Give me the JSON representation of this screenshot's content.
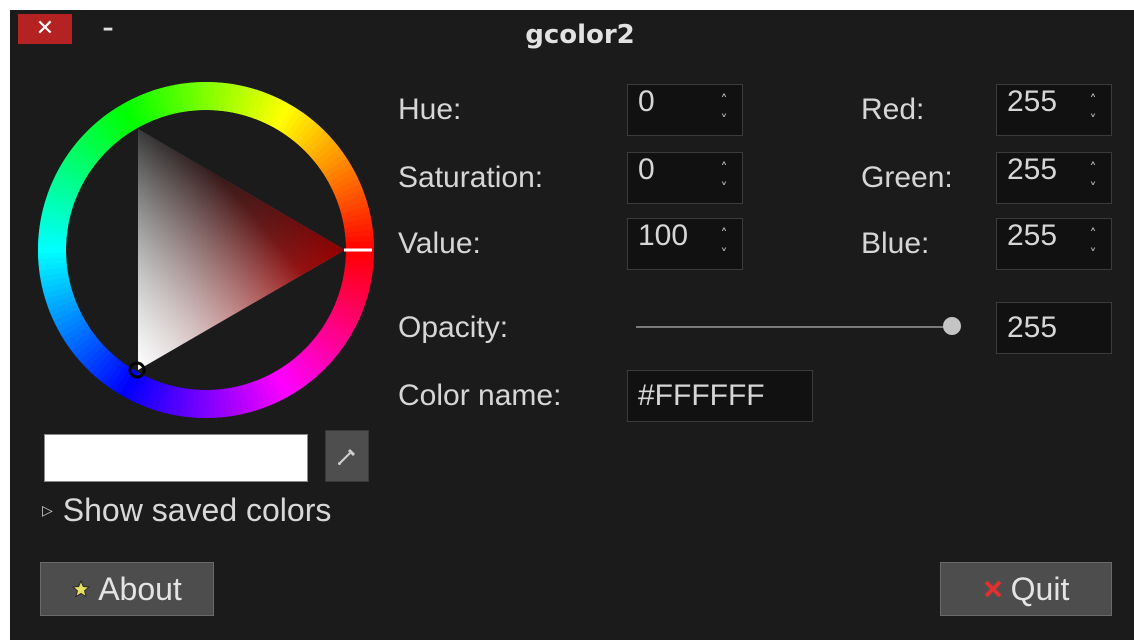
{
  "window": {
    "title": "gcolor2",
    "close_glyph": "✕",
    "minimize_glyph": "–"
  },
  "fields": {
    "hue": {
      "label": "Hue:",
      "value": "0"
    },
    "saturation": {
      "label": "Saturation:",
      "value": "0"
    },
    "value": {
      "label": "Value:",
      "value": "100"
    },
    "red": {
      "label": "Red:",
      "value": "255"
    },
    "green": {
      "label": "Green:",
      "value": "255"
    },
    "blue": {
      "label": "Blue:",
      "value": "255"
    },
    "opacity": {
      "label": "Opacity:",
      "value": "255",
      "level": 1.0
    },
    "color_name": {
      "label": "Color name:",
      "value": "#FFFFFF"
    }
  },
  "selected_color": "#FFFFFF",
  "saved_colors": {
    "label": "Show saved colors",
    "expanded": false,
    "arrow_glyph": "▷"
  },
  "buttons": {
    "about": "About",
    "quit": "Quit"
  },
  "icons": {
    "about": "star-icon",
    "quit": "x-icon",
    "eyedropper": "eyedropper-icon",
    "spin_up": "chevron-up-icon",
    "spin_down": "chevron-down-icon"
  },
  "spin_glyphs": {
    "up": "˄",
    "down": "˅"
  }
}
